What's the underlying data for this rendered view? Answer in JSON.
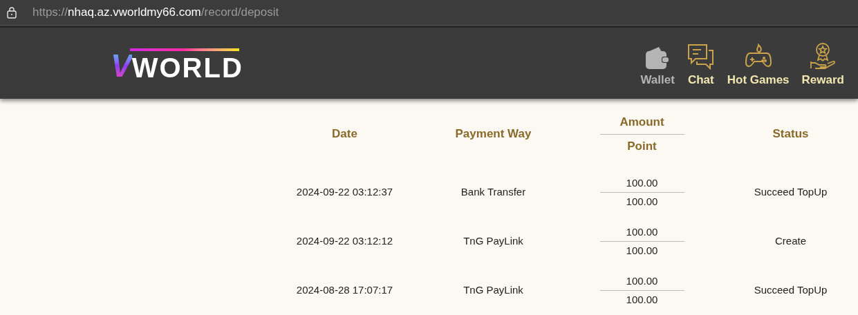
{
  "address_bar": {
    "scheme": "https://",
    "host": "nhaq.az.vworldmy66.com",
    "path": "/record/deposit"
  },
  "logo": {
    "mark": "V",
    "text": "WORLD"
  },
  "nav": [
    {
      "label": "Wallet",
      "kind": "wallet",
      "selected": true
    },
    {
      "label": "Chat",
      "kind": "chat",
      "selected": false
    },
    {
      "label": "Hot Games",
      "kind": "gamepad",
      "selected": false
    },
    {
      "label": "Reward",
      "kind": "reward",
      "selected": false
    }
  ],
  "table": {
    "columns": [
      {
        "kind": "single",
        "label": "Date"
      },
      {
        "kind": "single",
        "label": "Payment Way"
      },
      {
        "kind": "stacked",
        "label": "Amount",
        "sublabel": "Point"
      },
      {
        "kind": "single",
        "label": "Status"
      }
    ],
    "rows": [
      {
        "date": "2024-09-22 03:12:37",
        "payment_way": "Bank Transfer",
        "amount": "100.00",
        "point": "100.00",
        "status": "Succeed TopUp"
      },
      {
        "date": "2024-09-22 03:12:12",
        "payment_way": "TnG PayLink",
        "amount": "100.00",
        "point": "100.00",
        "status": "Create"
      },
      {
        "date": "2024-08-28 17:07:17",
        "payment_way": "TnG PayLink",
        "amount": "100.00",
        "point": "100.00",
        "status": "Succeed TopUp"
      }
    ]
  }
}
